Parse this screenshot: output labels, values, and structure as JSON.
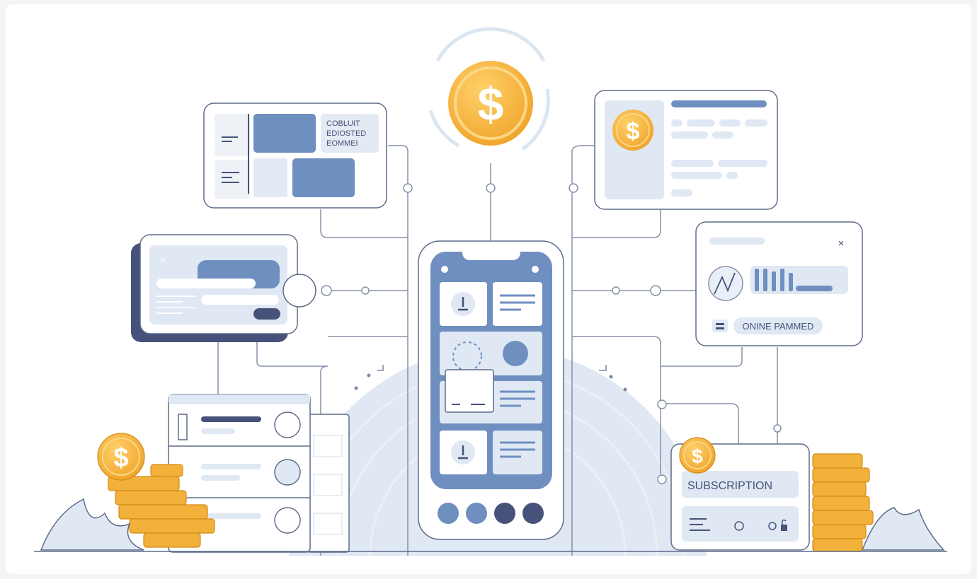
{
  "card_top_left": {
    "text_lines": [
      "COBLUIT",
      "EDIOSTED",
      "EOMMEI"
    ]
  },
  "card_right_middle": {
    "status_label": "ONINE PAMMED",
    "close_icon": "close-icon",
    "chart_icon": "trend-icon"
  },
  "subscription_card": {
    "title": "SUBSCRIPTION"
  },
  "colors": {
    "accent_blue": "#6f8fc1",
    "navy": "#46527a",
    "light_blue": "#dde7f2",
    "coin_gold": "#f2b13a",
    "outline": "#5f6b8a"
  },
  "icons": [
    "dollar-coin-icon",
    "lock-icon",
    "leaf-icon",
    "circle-icon"
  ]
}
